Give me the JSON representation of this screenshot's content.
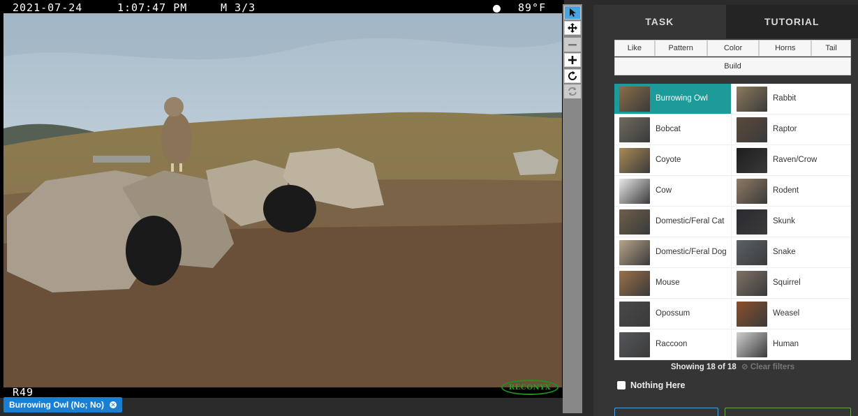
{
  "camera": {
    "date": "2021-07-24",
    "time": "1:07:47 PM",
    "frame": "M 3/3",
    "moon_icon": "full-moon-icon",
    "temperature": "89°F",
    "camera_id": "R49",
    "brand": "RECONYX"
  },
  "annotation": {
    "label": "Burrowing Owl (No; No)",
    "remove_icon": "close-icon"
  },
  "toolbar": {
    "tools": [
      "pointer-icon",
      "move-icon",
      "zoom-out-icon",
      "zoom-in-icon",
      "rotate-icon",
      "reset-icon"
    ]
  },
  "tabs": [
    {
      "label": "TASK",
      "active": true
    },
    {
      "label": "TUTORIAL",
      "active": false
    }
  ],
  "filters": {
    "row1": [
      "Like",
      "Pattern",
      "Color",
      "Horns",
      "Tail"
    ],
    "row2": [
      "Build"
    ]
  },
  "species": [
    {
      "name": "Burrowing Owl",
      "selected": true,
      "color": "#8a6d47"
    },
    {
      "name": "Rabbit",
      "selected": false,
      "color": "#8c7a5c"
    },
    {
      "name": "Bobcat",
      "selected": false,
      "color": "#6f6a5e"
    },
    {
      "name": "Raptor",
      "selected": false,
      "color": "#5b4a3a"
    },
    {
      "name": "Coyote",
      "selected": false,
      "color": "#a98a55"
    },
    {
      "name": "Raven/Crow",
      "selected": false,
      "color": "#1d1d1d"
    },
    {
      "name": "Cow",
      "selected": false,
      "color": "#e8e8e8"
    },
    {
      "name": "Rodent",
      "selected": false,
      "color": "#8f7a63"
    },
    {
      "name": "Domestic/Feral Cat",
      "selected": false,
      "color": "#6e5f4a"
    },
    {
      "name": "Skunk",
      "selected": false,
      "color": "#2a2a30"
    },
    {
      "name": "Domestic/Feral Dog",
      "selected": false,
      "color": "#b8a48a"
    },
    {
      "name": "Snake",
      "selected": false,
      "color": "#5a6268"
    },
    {
      "name": "Mouse",
      "selected": false,
      "color": "#9a7048"
    },
    {
      "name": "Squirrel",
      "selected": false,
      "color": "#7e7266"
    },
    {
      "name": "Opossum",
      "selected": false,
      "color": "#4a4848"
    },
    {
      "name": "Weasel",
      "selected": false,
      "color": "#8b4f2a"
    },
    {
      "name": "Raccoon",
      "selected": false,
      "color": "#55575a"
    },
    {
      "name": "Human",
      "selected": false,
      "color": "#cfcfcf"
    }
  ],
  "status": {
    "showing": "Showing 18 of 18",
    "clear_filters": "Clear filters"
  },
  "nothing_here": {
    "label": "Nothing Here",
    "checked": false
  }
}
